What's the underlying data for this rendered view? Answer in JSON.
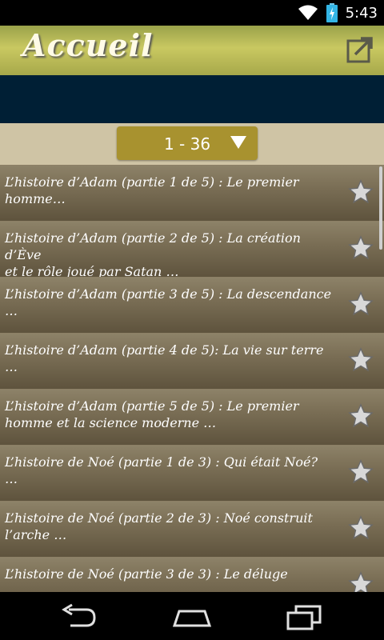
{
  "status_bar": {
    "time": "5:43"
  },
  "header": {
    "title": "Accueil"
  },
  "pager": {
    "label": "1 - 36"
  },
  "list": {
    "items": [
      {
        "line1": "L’histoire d’Adam (partie 1 de 5) : Le premier",
        "line2": "homme…"
      },
      {
        "line1": "L’histoire d’Adam (partie 2 de 5) : La création d’Ève",
        "line2": "et le rôle joué par Satan …"
      },
      {
        "line1": "L’histoire d’Adam (partie 3 de 5) : La descendance",
        "line2": "…"
      },
      {
        "line1": "L’histoire d’Adam (partie 4 de 5): La vie sur terre",
        "line2": "…"
      },
      {
        "line1": "L’histoire d’Adam (partie 5 de 5) : Le premier",
        "line2": "homme et la science moderne …"
      },
      {
        "line1": "L’histoire de Noé (partie 1 de 3) : Qui était Noé?",
        "line2": "…"
      },
      {
        "line1": "L’histoire de Noé (partie 2 de 3) : Noé construit",
        "line2": "l’arche …"
      },
      {
        "line1": "L’histoire de Noé (partie 3 de 3) : Le déluge",
        "line2": "…"
      }
    ]
  },
  "colors": {
    "header_bg": "#c9c861",
    "dark_band": "#001f35",
    "pager_bg": "#a8922f",
    "list_item_bg": "#7a6e55"
  },
  "icons": {
    "share": "share-external-icon",
    "star": "star-icon",
    "back": "back-icon",
    "home": "home-icon",
    "recents": "recents-icon"
  }
}
